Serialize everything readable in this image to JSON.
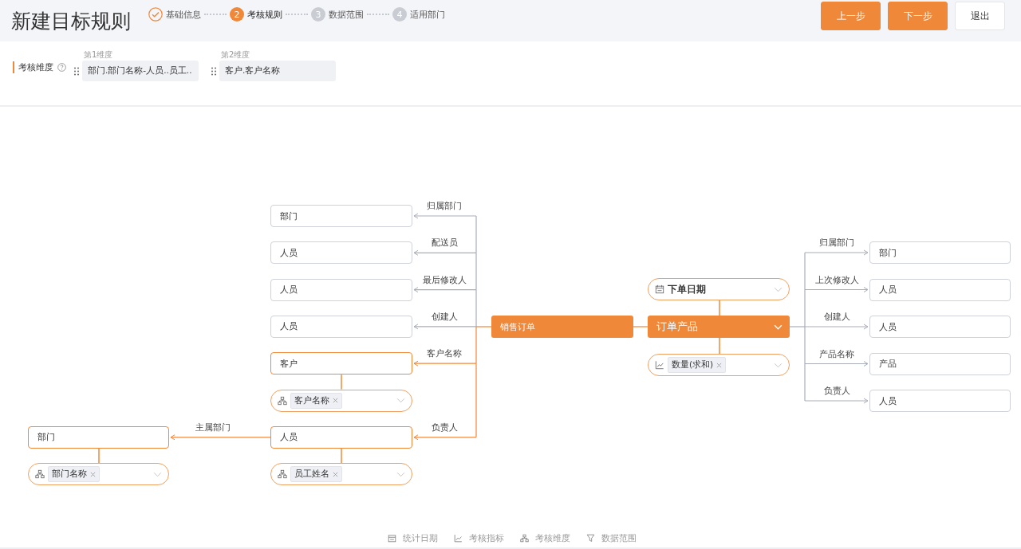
{
  "title": "新建目标规则",
  "steps": [
    {
      "label": "基础信息",
      "done": true,
      "selected": false
    },
    {
      "number": "2",
      "label": "考核规则",
      "done": false,
      "selected": true
    },
    {
      "number": "3",
      "label": "数据范围",
      "done": false,
      "selected": false
    },
    {
      "number": "4",
      "label": "适用部门",
      "done": false,
      "selected": false
    }
  ],
  "buttons": [
    {
      "label": "上一步",
      "kind": "primary"
    },
    {
      "label": "下一步",
      "kind": "primary"
    },
    {
      "label": "退出",
      "kind": "default"
    }
  ],
  "dimensions": {
    "label": "考核维度",
    "slots": [
      {
        "caption": "第1维度",
        "value": "部门.部门名称-人员..员工.."
      },
      {
        "caption": "第2维度",
        "value": "客户.客户名称"
      }
    ]
  },
  "diagram": {
    "root": {
      "label": "销售订单"
    },
    "left_links": [
      {
        "label": "归属部门",
        "target": "部门",
        "highlighted": false
      },
      {
        "label": "配送员",
        "target": "人员",
        "highlighted": false
      },
      {
        "label": "最后修改人",
        "target": "人员",
        "highlighted": false
      },
      {
        "label": "创建人",
        "target": "人员",
        "highlighted": false
      },
      {
        "label": "客户名称",
        "target": "客户",
        "highlighted": true,
        "field": {
          "kind": "dimension",
          "tags": [
            "客户名称"
          ]
        }
      },
      {
        "label": "负责人",
        "target": "人员",
        "highlighted": true,
        "field": {
          "kind": "dimension",
          "tags": [
            "员工姓名"
          ]
        },
        "sub_link": {
          "label": "主属部门",
          "target": "部门",
          "field": {
            "kind": "dimension",
            "tags": [
              "部门名称"
            ]
          }
        }
      }
    ],
    "child": {
      "label": "订单产品",
      "date_field": {
        "kind": "date",
        "text": "下单日期"
      },
      "metric_field": {
        "kind": "metric",
        "tags": [
          "数量(求和)"
        ]
      },
      "links": [
        {
          "label": "归属部门",
          "target": "部门"
        },
        {
          "label": "上次修改人",
          "target": "人员"
        },
        {
          "label": "创建人",
          "target": "人员"
        },
        {
          "label": "产品名称",
          "target": "产品"
        },
        {
          "label": "负责人",
          "target": "人员"
        }
      ]
    }
  },
  "legend": [
    {
      "kind": "date",
      "label": "统计日期"
    },
    {
      "kind": "metric",
      "label": "考核指标"
    },
    {
      "kind": "dimension",
      "label": "考核维度"
    },
    {
      "kind": "filter",
      "label": "数据范围"
    }
  ]
}
